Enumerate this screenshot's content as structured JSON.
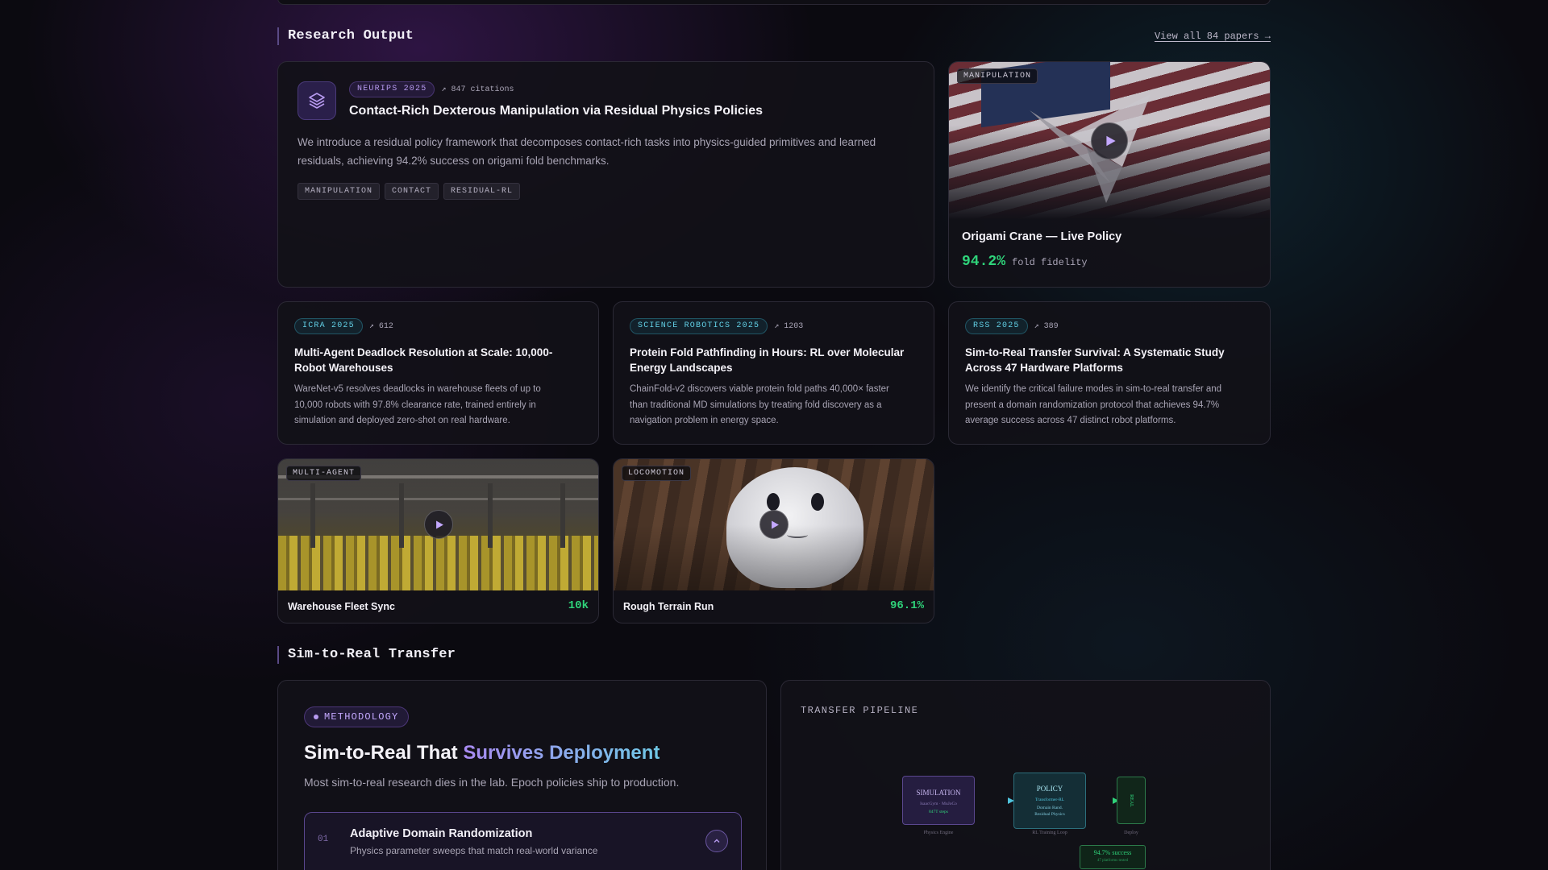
{
  "research": {
    "section_title": "Research Output",
    "view_all": "View all 84 papers →",
    "featured": {
      "venue": "NEURIPS 2025",
      "citations": "↗ 847 citations",
      "title": "Contact-Rich Dexterous Manipulation via Residual Physics Policies",
      "abstract": "We introduce a residual policy framework that decomposes contact-rich tasks into physics-guided primitives and learned residuals, achieving 94.2% success on origami fold benchmarks.",
      "tags": [
        "MANIPULATION",
        "CONTACT",
        "RESIDUAL-RL"
      ],
      "icon": "layers-icon"
    },
    "featured_video": {
      "label": "MANIPULATION",
      "title": "Origami Crane — Live Policy",
      "stat": "94.2%",
      "stat_label": "fold fidelity"
    },
    "papers": [
      {
        "venue": "ICRA 2025",
        "citations": "↗ 612",
        "title": "Multi-Agent Deadlock Resolution at Scale: 10,000-Robot Warehouses",
        "abstract": "WareNet-v5 resolves deadlocks in warehouse fleets of up to 10,000 robots with 97.8% clearance rate, trained entirely in simulation and deployed zero-shot on real hardware."
      },
      {
        "venue": "SCIENCE ROBOTICS 2025",
        "citations": "↗ 1203",
        "title": "Protein Fold Pathfinding in Hours: RL over Molecular Energy Landscapes",
        "abstract": "ChainFold-v2 discovers viable protein fold paths 40,000× faster than traditional MD simulations by treating fold discovery as a navigation problem in energy space."
      },
      {
        "venue": "RSS 2025",
        "citations": "↗ 389",
        "title": "Sim-to-Real Transfer Survival: A Systematic Study Across 47 Hardware Platforms",
        "abstract": "We identify the critical failure modes in sim-to-real transfer and present a domain randomization protocol that achieves 94.7% average success across 47 distinct robot platforms."
      }
    ],
    "videos": [
      {
        "label": "MULTI-AGENT",
        "title": "Warehouse Fleet Sync",
        "stat": "10k"
      },
      {
        "label": "LOCOMOTION",
        "title": "Rough Terrain Run",
        "stat": "96.1%"
      }
    ]
  },
  "sim2real": {
    "section_title": "Sim-to-Real Transfer",
    "badge": "METHODOLOGY",
    "heading_plain": "Sim-to-Real That ",
    "heading_accent": "Survives Deployment",
    "subheading": "Most sim-to-real research dies in the lab. Epoch policies ship to production.",
    "accordion": {
      "number": "01",
      "title": "Adaptive Domain Randomization",
      "desc": "Physics parameter sweeps that match real-world variance"
    },
    "pipeline": {
      "title": "TRANSFER PIPELINE",
      "sim_title": "SIMULATION",
      "sim_sub": "IsaacGym · MuJoCo",
      "sim_stat": "847T steps",
      "sim_caption": "Physics Engine",
      "policy_title": "POLICY",
      "policy_sub": "Transformer-RL",
      "policy_line1": "Domain Rand.",
      "policy_line2": "Residual Physics",
      "policy_caption": "RL Training Loop",
      "real_title": "REAL",
      "real_caption": "Deploy",
      "success_title": "94.7% success",
      "success_sub": "47 platforms tested"
    }
  },
  "colors": {
    "accent_purple": "#8b6fe0",
    "accent_teal": "#4fc3dc",
    "success_green": "#2fd37a"
  }
}
